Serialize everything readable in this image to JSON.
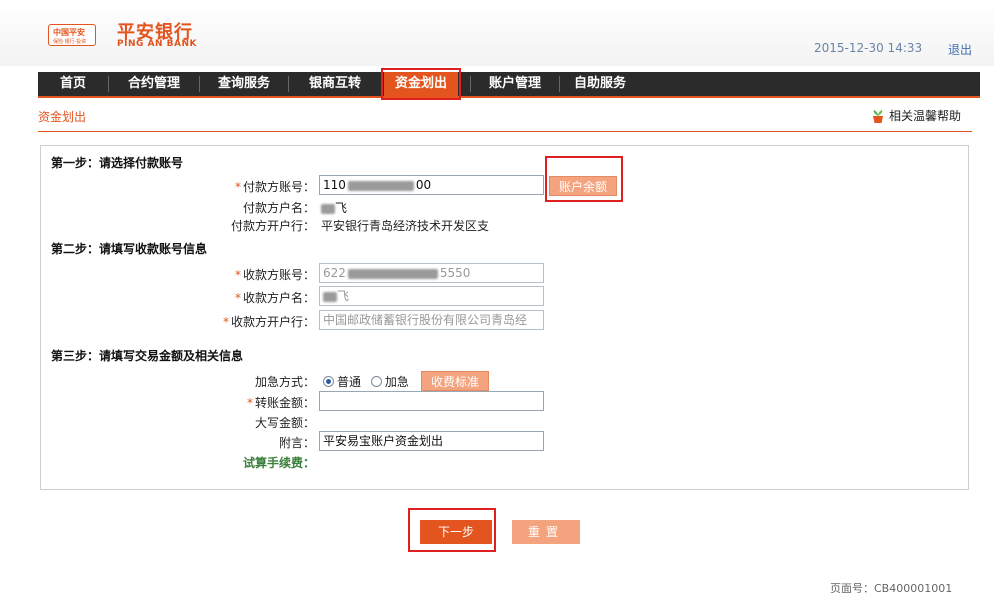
{
  "header": {
    "logo_badge_top": "中国平安",
    "logo_badge_sub": "保险·银行·投资",
    "logo_cn": "平安银行",
    "logo_en": "PING AN BANK",
    "datetime": "2015-12-30  14:33",
    "logout": "退出"
  },
  "nav": {
    "items": [
      {
        "label": "首页"
      },
      {
        "label": "合约管理"
      },
      {
        "label": "查询服务"
      },
      {
        "label": "银商互转"
      },
      {
        "label": "资金划出"
      },
      {
        "label": "账户管理"
      },
      {
        "label": "自助服务"
      }
    ],
    "active_index": 4
  },
  "breadcrumb": "资金划出",
  "help": "相关温馨帮助",
  "step1": {
    "title": "第一步：请选择付款账号",
    "payer_account_label": "付款方账号：",
    "payer_account_prefix": "110",
    "payer_account_suffix": "00",
    "balance_button": "账户余额",
    "payer_name_label": "付款方户名：",
    "payer_name_suffix": "飞",
    "payer_bank_label": "付款方开户行：",
    "payer_bank": "平安银行青岛经济技术开发区支"
  },
  "step2": {
    "title": "第二步：请填写收款账号信息",
    "payee_account_label": "收款方账号：",
    "payee_account_prefix": "622",
    "payee_account_suffix": "5550",
    "payee_name_label": "收款方户名：",
    "payee_name_suffix": "飞",
    "payee_bank_label": "收款方开户行：",
    "payee_bank": "中国邮政储蓄银行股份有限公司青岛经"
  },
  "step3": {
    "title": "第三步：请填写交易金额及相关信息",
    "urgency_label": "加急方式：",
    "urgency_normal": "普通",
    "urgency_urgent": "加急",
    "fee_standard_button": "收费标准",
    "amount_label": "转账金额：",
    "amount_value": "",
    "amount_upper_label": "大写金额：",
    "remark_label": "附言：",
    "remark_value": "平安易宝账户资金划出",
    "fee_calc_label": "试算手续费："
  },
  "buttons": {
    "next": "下一步",
    "reset": "重置"
  },
  "page_number": "页面号：CB400001001",
  "colors": {
    "brand": "#e3541f",
    "nav_bg": "#2b2b2b",
    "highlight_frame": "#e02020"
  }
}
